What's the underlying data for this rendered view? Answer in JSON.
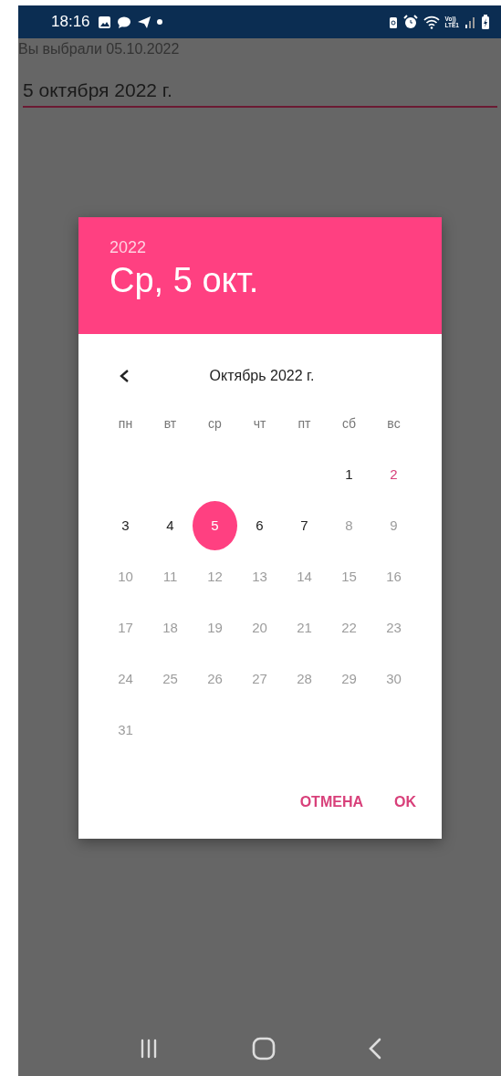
{
  "status_bar": {
    "time": "18:16",
    "network_top": "Vo))",
    "network_bottom": "LTE1"
  },
  "app": {
    "selected_text": "Вы выбрали 05.10.2022",
    "date_field": {
      "value": "5 октября 2022 г."
    }
  },
  "dialog": {
    "year": "2022",
    "date": "Ср, 5 окт.",
    "month": "Октябрь 2022 г.",
    "weekdays": [
      "пн",
      "вт",
      "ср",
      "чт",
      "пт",
      "сб",
      "вс"
    ],
    "weeks": [
      {
        "right_aligned": true,
        "days": [
          {
            "day": "1",
            "disabled": false,
            "selected": false,
            "highlighted": false
          },
          {
            "day": "2",
            "disabled": false,
            "selected": false,
            "highlighted": true
          }
        ]
      },
      {
        "right_aligned": false,
        "days": [
          {
            "day": "3",
            "disabled": false,
            "selected": false,
            "highlighted": false
          },
          {
            "day": "4",
            "disabled": false,
            "selected": false,
            "highlighted": false
          },
          {
            "day": "5",
            "disabled": false,
            "selected": true,
            "highlighted": false
          },
          {
            "day": "6",
            "disabled": false,
            "selected": false,
            "highlighted": false
          },
          {
            "day": "7",
            "disabled": false,
            "selected": false,
            "highlighted": false
          },
          {
            "day": "8",
            "disabled": true,
            "selected": false,
            "highlighted": false
          },
          {
            "day": "9",
            "disabled": true,
            "selected": false,
            "highlighted": false
          }
        ]
      },
      {
        "right_aligned": false,
        "days": [
          {
            "day": "10",
            "disabled": true,
            "selected": false,
            "highlighted": false
          },
          {
            "day": "11",
            "disabled": true,
            "selected": false,
            "highlighted": false
          },
          {
            "day": "12",
            "disabled": true,
            "selected": false,
            "highlighted": false
          },
          {
            "day": "13",
            "disabled": true,
            "selected": false,
            "highlighted": false
          },
          {
            "day": "14",
            "disabled": true,
            "selected": false,
            "highlighted": false
          },
          {
            "day": "15",
            "disabled": true,
            "selected": false,
            "highlighted": false
          },
          {
            "day": "16",
            "disabled": true,
            "selected": false,
            "highlighted": false
          }
        ]
      },
      {
        "right_aligned": false,
        "days": [
          {
            "day": "17",
            "disabled": true,
            "selected": false,
            "highlighted": false
          },
          {
            "day": "18",
            "disabled": true,
            "selected": false,
            "highlighted": false
          },
          {
            "day": "19",
            "disabled": true,
            "selected": false,
            "highlighted": false
          },
          {
            "day": "20",
            "disabled": true,
            "selected": false,
            "highlighted": false
          },
          {
            "day": "21",
            "disabled": true,
            "selected": false,
            "highlighted": false
          },
          {
            "day": "22",
            "disabled": true,
            "selected": false,
            "highlighted": false
          },
          {
            "day": "23",
            "disabled": true,
            "selected": false,
            "highlighted": false
          }
        ]
      },
      {
        "right_aligned": false,
        "days": [
          {
            "day": "24",
            "disabled": true,
            "selected": false,
            "highlighted": false
          },
          {
            "day": "25",
            "disabled": true,
            "selected": false,
            "highlighted": false
          },
          {
            "day": "26",
            "disabled": true,
            "selected": false,
            "highlighted": false
          },
          {
            "day": "27",
            "disabled": true,
            "selected": false,
            "highlighted": false
          },
          {
            "day": "28",
            "disabled": true,
            "selected": false,
            "highlighted": false
          },
          {
            "day": "29",
            "disabled": true,
            "selected": false,
            "highlighted": false
          },
          {
            "day": "30",
            "disabled": true,
            "selected": false,
            "highlighted": false
          }
        ]
      },
      {
        "right_aligned": false,
        "days": [
          {
            "day": "31",
            "disabled": true,
            "selected": false,
            "highlighted": false
          }
        ]
      }
    ],
    "buttons": [
      "ОТМЕНА",
      "OK"
    ]
  }
}
